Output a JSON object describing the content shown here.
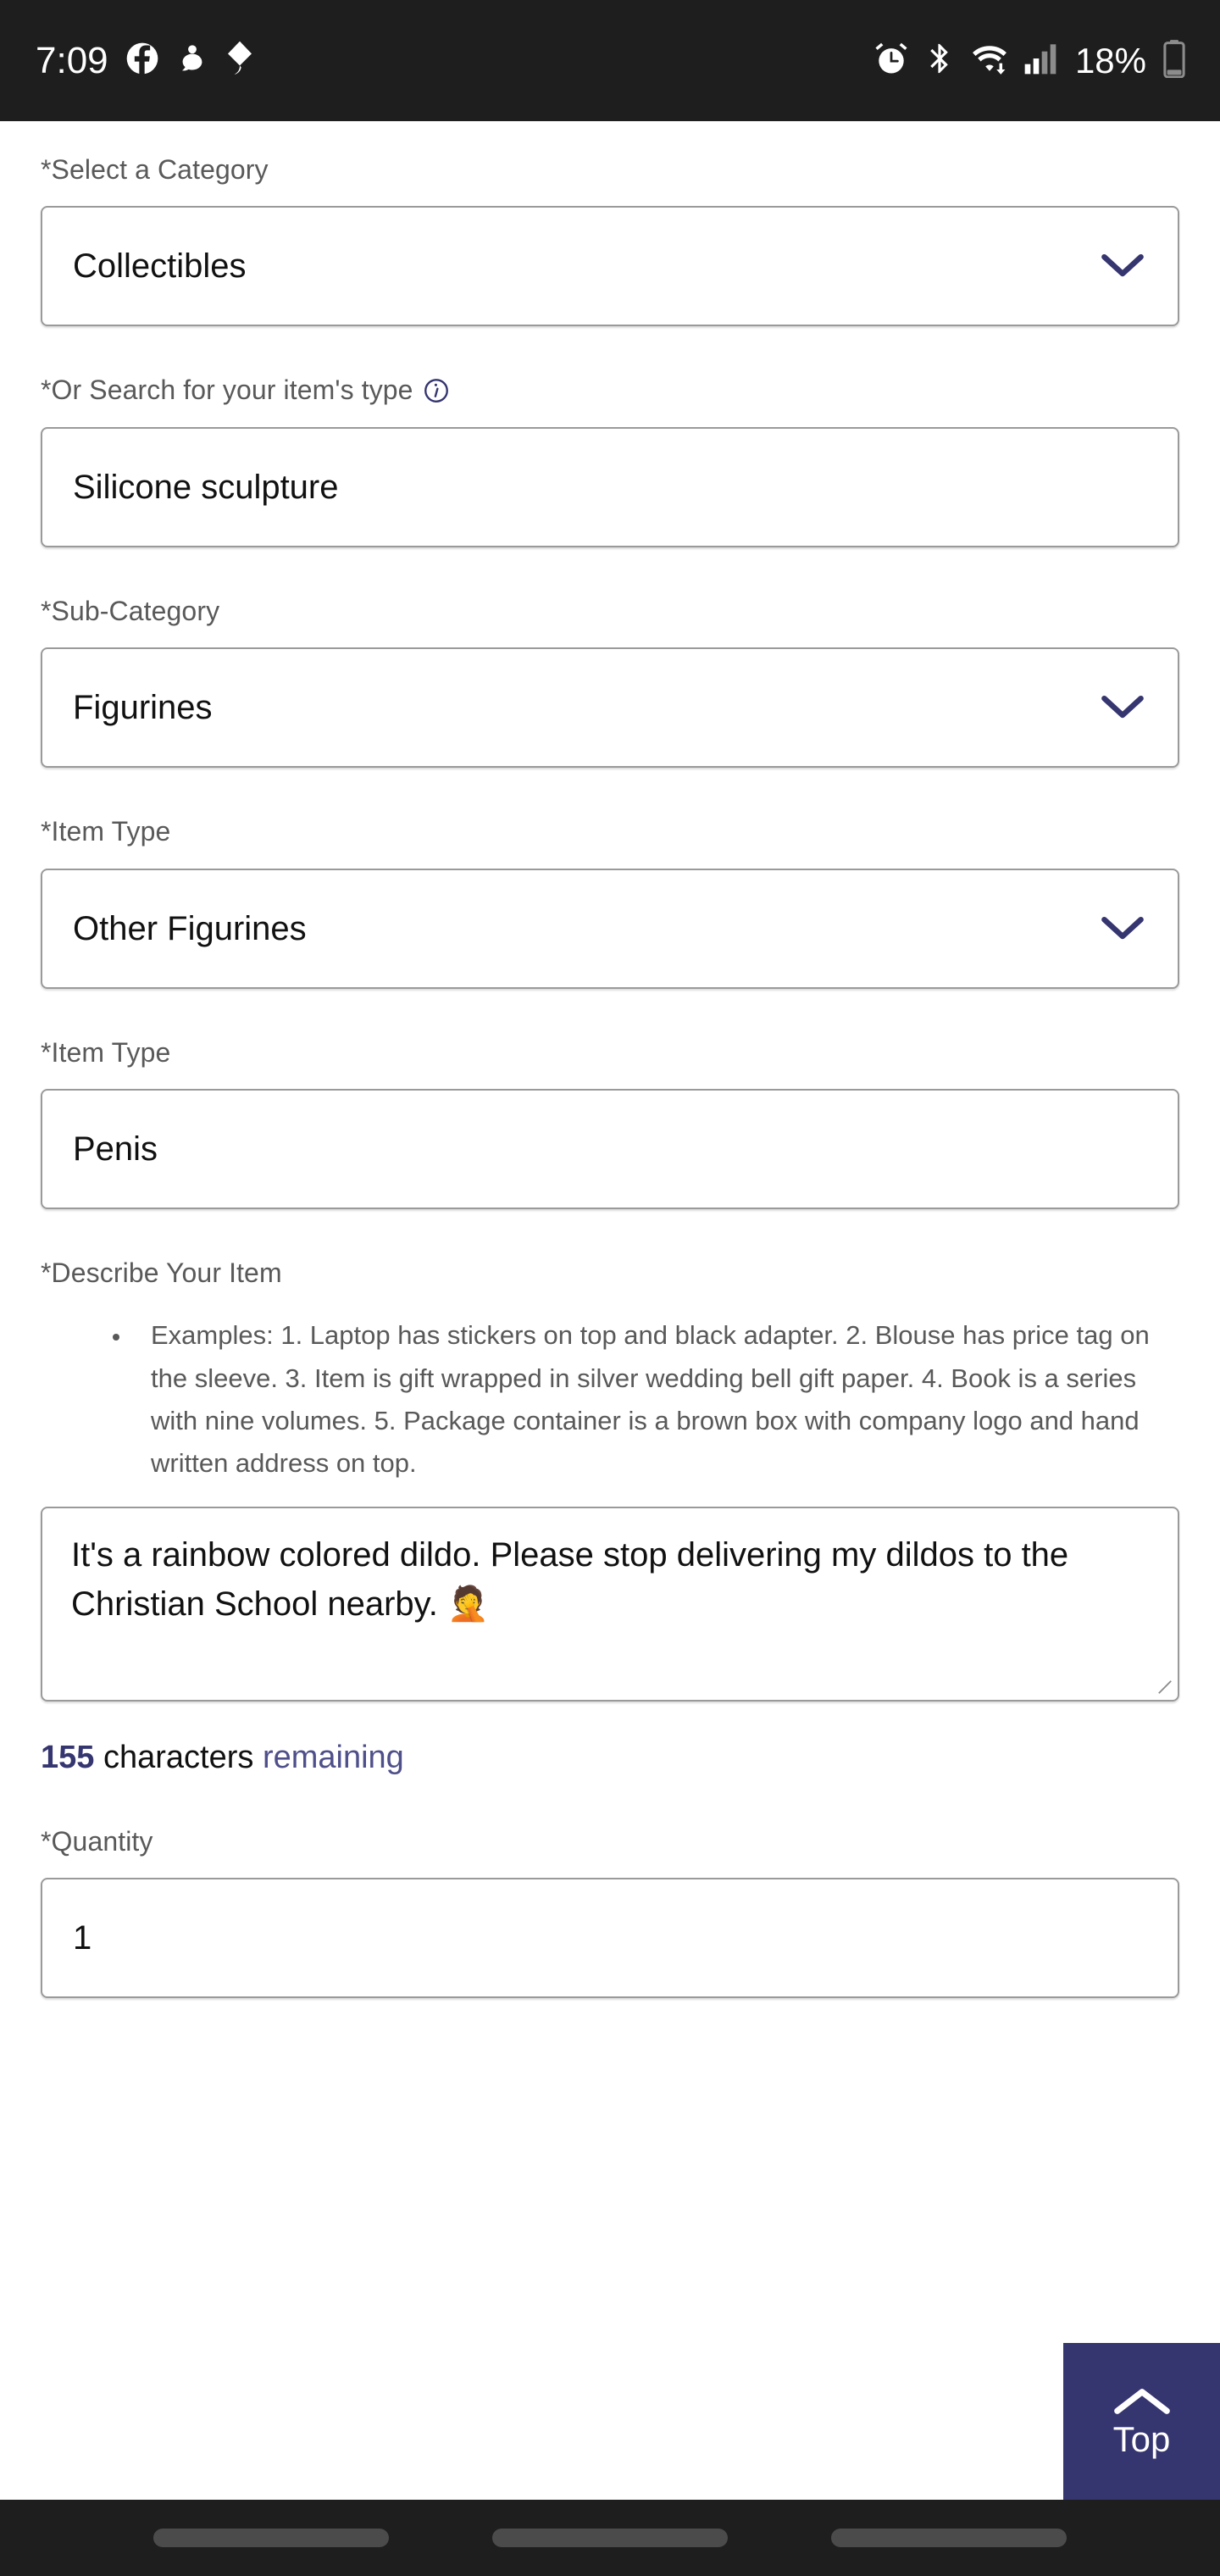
{
  "status_bar": {
    "time": "7:09",
    "battery_percent": "18%",
    "left_icons": [
      "facebook-icon",
      "reddit-snoo-icon",
      "kite-icon"
    ],
    "right_icons": [
      "alarm-icon",
      "bluetooth-icon",
      "wifi-icon",
      "cellular-signal-icon",
      "battery-icon"
    ],
    "background_color": "#1e1e1e"
  },
  "form": {
    "category": {
      "label": "*Select a Category",
      "value": "Collectibles"
    },
    "item_type_search": {
      "label": "*Or Search for your item's type",
      "info_icon": "info-circle-icon",
      "value": "Silicone sculpture"
    },
    "sub_category": {
      "label": "*Sub-Category",
      "value": "Figurines"
    },
    "item_type_select": {
      "label": "*Item Type",
      "value": "Other Figurines"
    },
    "item_type_text": {
      "label": "*Item Type",
      "value": "Penis"
    },
    "describe": {
      "label": "*Describe Your Item",
      "examples": "Examples: 1. Laptop has stickers on top and black adapter. 2. Blouse has price tag on the sleeve. 3. Item is gift wrapped in silver wedding bell gift paper. 4. Book is a series with nine volumes. 5. Package container is a brown box with company logo and hand written address on top.",
      "value": "It's a rainbow colored dildo. Please stop delivering my dildos to the Christian School nearby. 🤦",
      "char_count": "155",
      "char_count_word": "characters",
      "char_count_tail": "remaining"
    },
    "quantity": {
      "label": "*Quantity",
      "value": "1"
    }
  },
  "top_button": {
    "label": "Top",
    "icon": "chevron-up-icon",
    "background_color": "#353570"
  },
  "nav_bar": {
    "items": [
      "recents-pill",
      "home-pill",
      "back-pill"
    ]
  },
  "colors": {
    "accent_navy": "#353570",
    "label_gray": "#595959",
    "border_gray": "#9a9a9a",
    "status_dark": "#1e1e1e"
  }
}
